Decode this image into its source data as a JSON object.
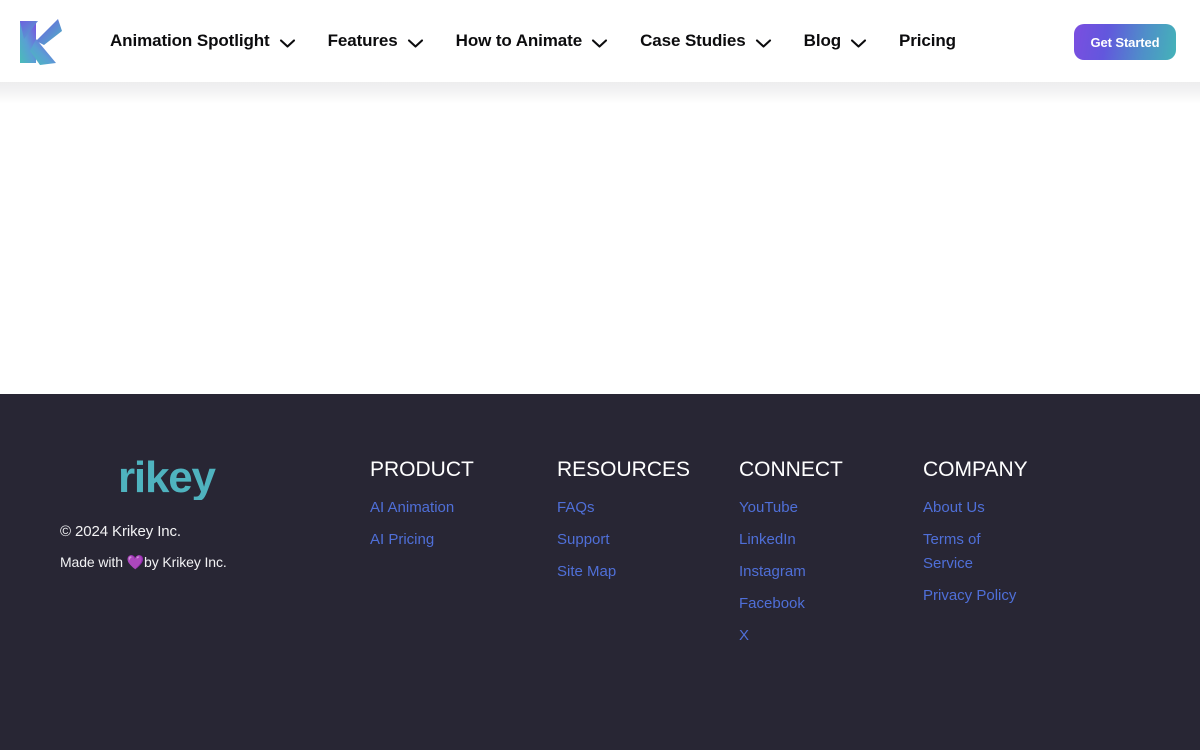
{
  "colors": {
    "page_bg": "#ffffff",
    "footer_bg": "#282634",
    "nav_text": "#0c0c0e",
    "footer_link": "#4f6fd8",
    "brand_teal": "#4fb3bf",
    "cta_gradient_start": "#7b4ee0",
    "cta_gradient_end": "#44b3b8",
    "heart_purple": "#b36ae8"
  },
  "header": {
    "logo_icon": "krikey-k-logo",
    "nav": [
      {
        "label": "Animation Spotlight",
        "has_dropdown": true,
        "icon": "chevron-down-icon"
      },
      {
        "label": "Features",
        "has_dropdown": true,
        "icon": "chevron-down-icon"
      },
      {
        "label": "How to Animate",
        "has_dropdown": true,
        "icon": "chevron-down-icon"
      },
      {
        "label": "Case Studies",
        "has_dropdown": true,
        "icon": "chevron-down-icon"
      },
      {
        "label": "Blog",
        "has_dropdown": true,
        "icon": "chevron-down-icon"
      },
      {
        "label": "Pricing",
        "has_dropdown": false,
        "icon": ""
      }
    ],
    "cta_label": "Get Started"
  },
  "footer": {
    "brand_logo_text": "rikey",
    "copyright": "© 2024 Krikey Inc.",
    "made_with_prefix": "Made with ",
    "made_with_heart": "💜",
    "made_with_suffix": "by Krikey Inc.",
    "columns": [
      {
        "heading": "PRODUCT",
        "links": [
          "AI Animation",
          "AI Pricing"
        ]
      },
      {
        "heading": "RESOURCES",
        "links": [
          "FAQs",
          "Support",
          "Site Map"
        ]
      },
      {
        "heading": "CONNECT",
        "links": [
          "YouTube",
          "LinkedIn",
          "Instagram",
          "Facebook",
          "X"
        ]
      },
      {
        "heading": "COMPANY",
        "links": [
          "About Us",
          "Terms of Service",
          "Privacy Policy"
        ]
      }
    ]
  }
}
